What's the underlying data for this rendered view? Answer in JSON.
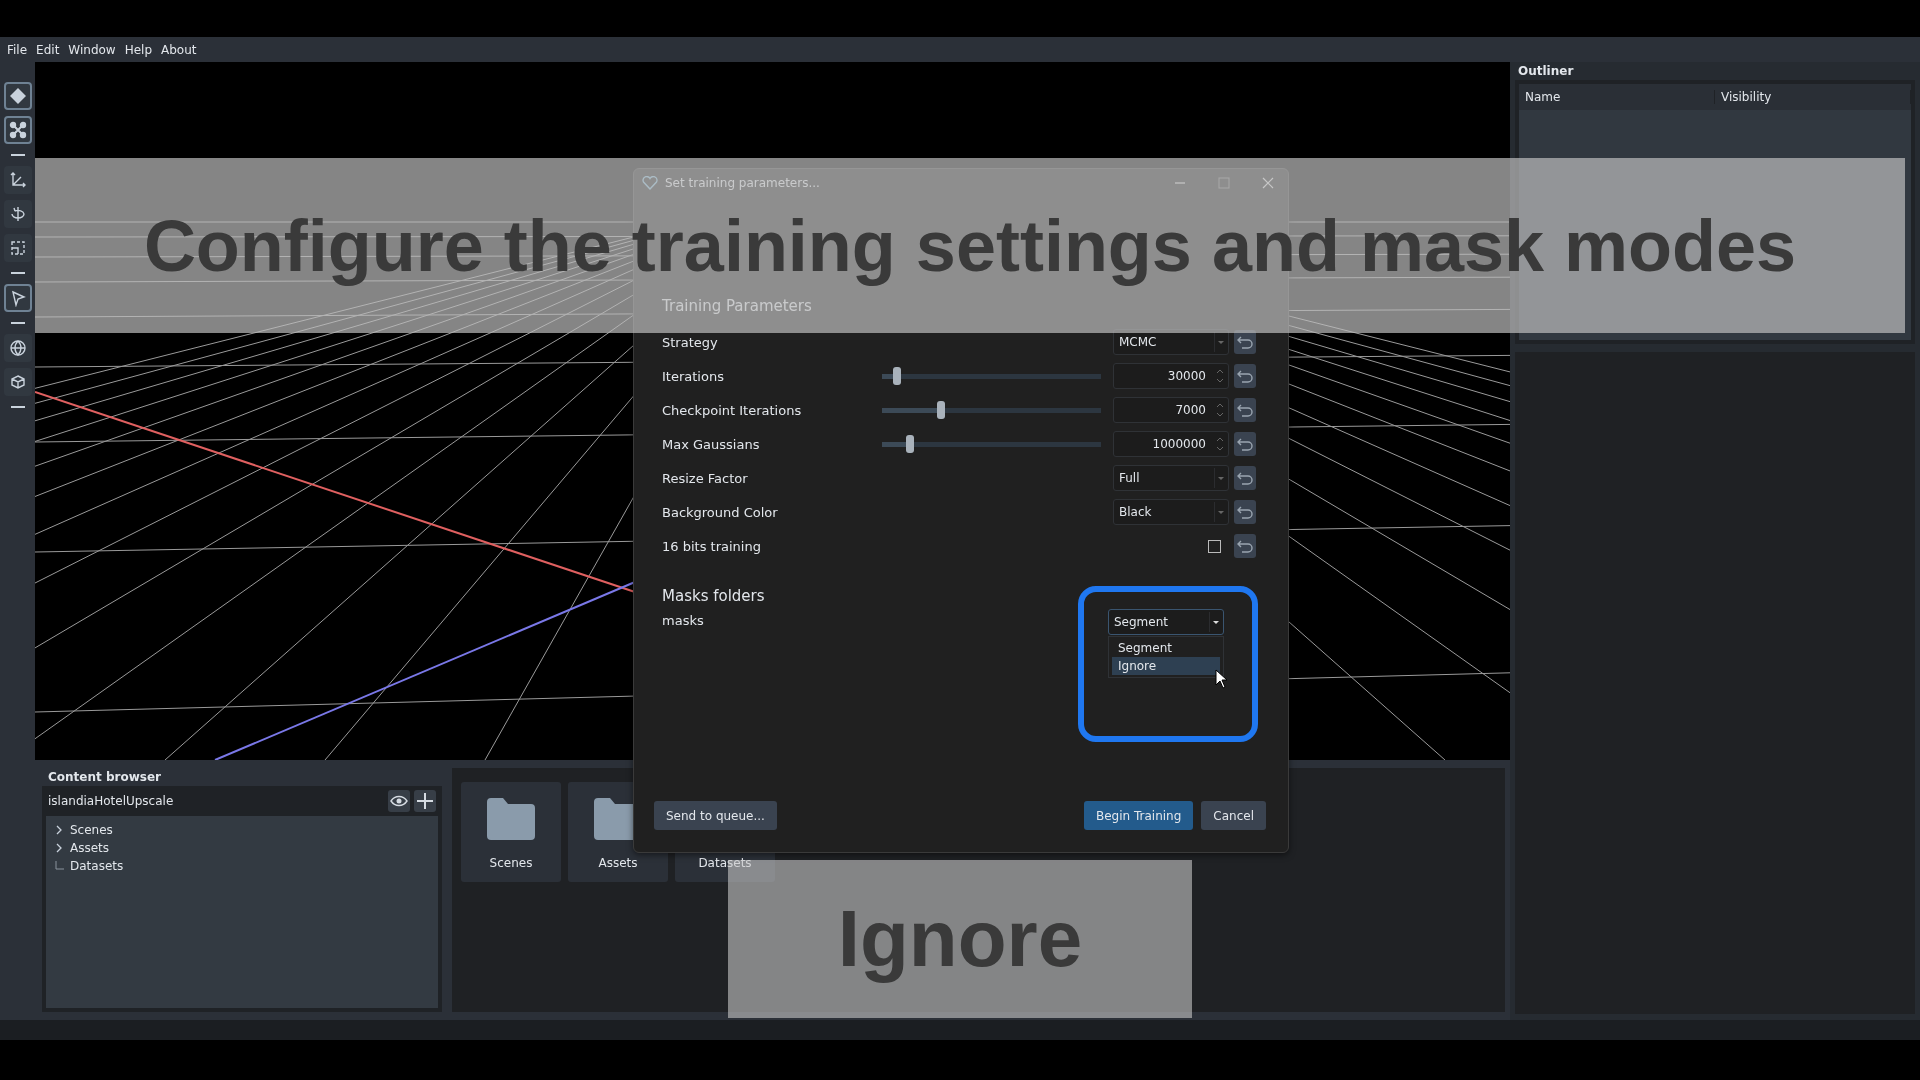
{
  "menu": [
    "File",
    "Edit",
    "Window",
    "Help",
    "About"
  ],
  "tools": [
    {
      "kind": "diamond",
      "selected": true
    },
    {
      "kind": "nodes",
      "selected": true
    },
    {
      "kind": "sep"
    },
    {
      "kind": "axes",
      "selected": false
    },
    {
      "kind": "rotate",
      "selected": false
    },
    {
      "kind": "scale",
      "selected": false
    },
    {
      "kind": "sep"
    },
    {
      "kind": "pointer",
      "selected": true
    },
    {
      "kind": "sep"
    },
    {
      "kind": "globe",
      "selected": false
    },
    {
      "kind": "cube",
      "selected": false
    },
    {
      "kind": "sep"
    }
  ],
  "outliner": {
    "title": "Outliner",
    "columns": [
      "Name",
      "Visibility"
    ]
  },
  "content_browser": {
    "title": "Content browser",
    "project": "islandiaHotelUpscale",
    "tree": [
      {
        "label": "Scenes",
        "expandable": true
      },
      {
        "label": "Assets",
        "expandable": true
      },
      {
        "label": "Datasets",
        "expandable": false
      }
    ],
    "folders": [
      {
        "label": "Scenes"
      },
      {
        "label": "Assets"
      },
      {
        "label": "Datasets"
      }
    ]
  },
  "dialog": {
    "title": "Set training parameters...",
    "section": "Training Parameters",
    "params": [
      {
        "kind": "select",
        "label": "Strategy",
        "value": "MCMC"
      },
      {
        "kind": "slider",
        "label": "Iterations",
        "value": "30000",
        "level": 0.05
      },
      {
        "kind": "slider",
        "label": "Checkpoint Iterations",
        "value": "7000",
        "level": 0.25
      },
      {
        "kind": "slider",
        "label": "Max Gaussians",
        "value": "1000000",
        "level": 0.11
      },
      {
        "kind": "select",
        "label": "Resize Factor",
        "value": "Full"
      },
      {
        "kind": "select",
        "label": "Background Color",
        "value": "Black"
      },
      {
        "kind": "checkbox",
        "label": "16 bits training",
        "checked": false
      }
    ],
    "masks": {
      "title": "Masks folders",
      "folders": [
        {
          "name": "masks",
          "value": "Segment",
          "options": [
            {
              "label": "Segment",
              "highlighted": false
            },
            {
              "label": "Ignore",
              "highlighted": true
            }
          ]
        }
      ]
    },
    "buttons": [
      {
        "label": "Send to queue...",
        "kind": "secondary"
      },
      {
        "label": "Begin Training",
        "kind": "primary"
      },
      {
        "label": "Cancel",
        "kind": "secondary"
      }
    ]
  },
  "captions": [
    {
      "text": "Configure the training settings and mask modes"
    },
    {
      "text": "Ignore"
    }
  ]
}
